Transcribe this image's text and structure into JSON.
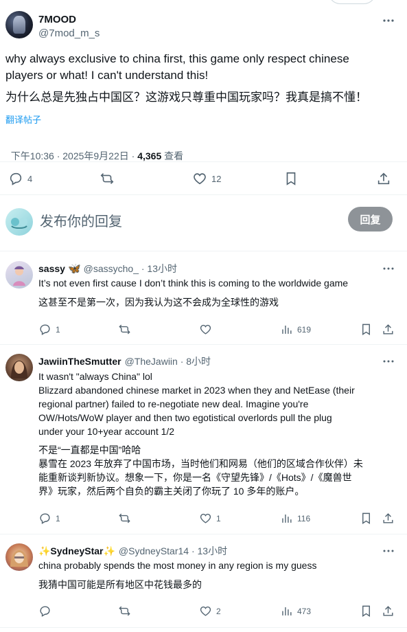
{
  "main_post": {
    "author_name": "7MOOD",
    "author_handle": "@7mod_m_s",
    "text_en_1": "why always exclusive to china first, this game only respect chinese",
    "text_en_2": "players or what! I can't understand this!",
    "text_zh": "为什么总是先独占中国区？这游戏只尊重中国玩家吗？我真是搞不懂！",
    "translate_label": "翻译帖子",
    "timestamp": "下午10:36 · 2025年9月22日 · ",
    "views_count": "4,365",
    "views_label": " 查看",
    "replies": "4",
    "likes": "12"
  },
  "reply_composer": {
    "prompt": "发布你的回复",
    "button_label": "回复"
  },
  "replies": [
    {
      "name": "sassy",
      "name_emoji": "🦋",
      "handle_time": "@sassycho_ · 13小时",
      "lines": [
        "It’s not even first cause I don’t think this is coming to the worldwide game",
        "",
        "这甚至不是第一次，因为我认为这不会成为全球性的游戏"
      ],
      "reply_count": "1",
      "retweet_count": "",
      "like_count": "",
      "views": "619"
    },
    {
      "name": "JawiinTheSmutter",
      "name_emoji": "",
      "handle_time": "@TheJawiin · 8小时",
      "lines": [
        "It wasn't \"always China\" lol",
        "Blizzard abandoned chinese market in 2023 when they and NetEase (their",
        "regional partner) failed to re-negotiate new deal. Imagine you're",
        "OW/Hots/WoW player and then two egotistical overlords pull the plug",
        "under your 10+year account 1/2",
        "",
        "不是“一直都是中国”哈哈",
        "暴雪在 2023 年放弃了中国市场，当时他们和网易（他们的区域合作伙伴）未",
        "能重新谈判新协议。想象一下，你是一名《守望先锋》/《Hots》/《魔兽世",
        "界》玩家，然后两个自负的霸主关闭了你玩了 10 多年的账户。"
      ],
      "reply_count": "1",
      "retweet_count": "",
      "like_count": "1",
      "views": "116"
    },
    {
      "name": "✨SydneyStar✨",
      "name_emoji": "",
      "handle_time": "@SydneyStar14 · 13小时",
      "lines": [
        "china probably spends the most money in any region is my guess",
        "",
        "我猜中国可能是所有地区中花钱最多的"
      ],
      "reply_count": "",
      "retweet_count": "",
      "like_count": "2",
      "views": "473"
    }
  ],
  "colors": {
    "text": "#0f1419",
    "secondary": "#536471",
    "link": "#1d9bf0",
    "divider": "#eff3f4",
    "reply_button": "#8e9398"
  }
}
